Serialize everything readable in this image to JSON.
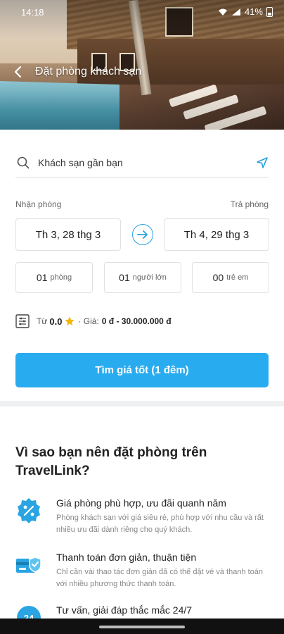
{
  "status_bar": {
    "time": "14:18",
    "battery": "41%"
  },
  "header": {
    "title": "Đặt phòng khách sạn"
  },
  "search": {
    "text": "Khách sạn gần bạn"
  },
  "dates": {
    "checkin_label": "Nhận phòng",
    "checkout_label": "Trả phòng",
    "checkin_value": "Th 3, 28 thg 3",
    "checkout_value": "Th 4, 29 thg 3"
  },
  "guests": {
    "rooms_num": "01",
    "rooms_unit": "phòng",
    "adults_num": "01",
    "adults_unit": "người lớn",
    "children_num": "00",
    "children_unit": "trẻ em"
  },
  "filter": {
    "from_label": "Từ",
    "rating": "0.0",
    "price_label": "· Giá:",
    "price_range": "0 đ - 30.000.000 đ"
  },
  "cta": {
    "label": "Tìm giá tốt (1 đêm)"
  },
  "why": {
    "title": "Vì sao bạn nên đặt phòng trên TravelLink?",
    "features": [
      {
        "title": "Giá phòng phù hợp, ưu đãi quanh năm",
        "desc": "Phòng khách sạn với giá siêu rẻ, phù hợp với nhu cầu và rất nhiều ưu đãi dành riêng cho quý khách.",
        "icon": "discount-badge-icon"
      },
      {
        "title": "Thanh toán đơn giản, thuận tiện",
        "desc": "Chỉ cần vài thao tác đơn giản đã có thể đặt vé và thanh toán với nhiều phương thức thanh toán.",
        "icon": "secure-card-icon"
      },
      {
        "title": "Tư vấn, giải đáp thắc mắc 24/7",
        "desc": "",
        "icon": "support-24-icon"
      }
    ]
  },
  "colors": {
    "accent": "#29abf0",
    "text": "#222222",
    "muted": "#888888"
  }
}
